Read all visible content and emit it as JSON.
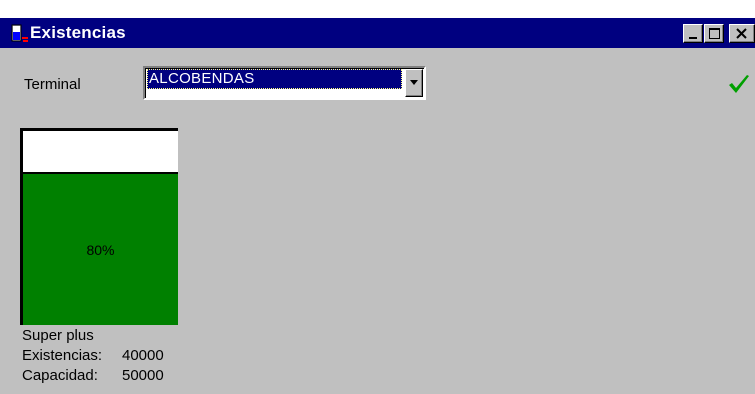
{
  "window": {
    "title": "Existencias",
    "controls": [
      "minimize-icon",
      "maximize-icon",
      "close-icon"
    ]
  },
  "form": {
    "terminal_label": "Terminal",
    "terminal_value": "ALCOBENDAS",
    "confirm_icon": "checkmark-icon",
    "confirm_color": "#00a000"
  },
  "tank": {
    "percent_label": "80%",
    "fill_fraction": 0.8,
    "fill_color": "#008000",
    "product": "Super plus",
    "stock_label": "Existencias:",
    "stock_value": "40000",
    "capacity_label": "Capacidad:",
    "capacity_value": "50000"
  }
}
